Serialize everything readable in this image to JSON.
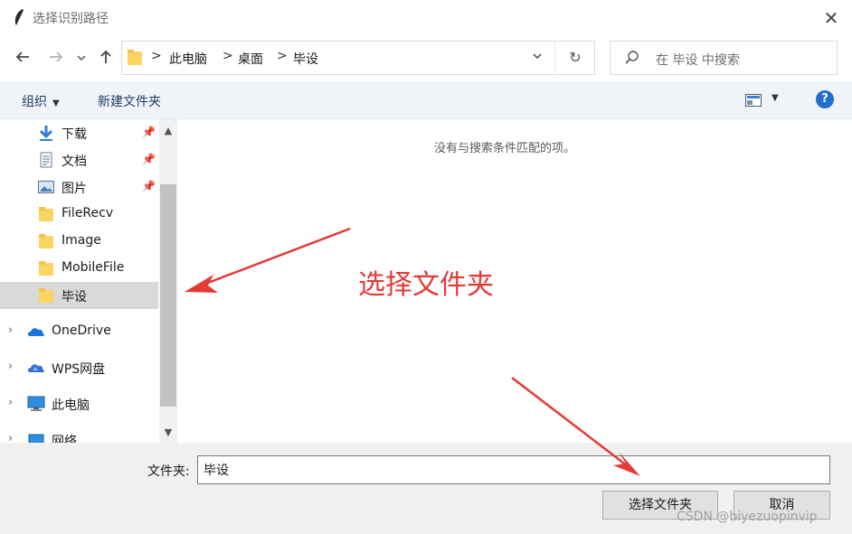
{
  "window": {
    "title": "选择识别路径",
    "close_glyph": "✕"
  },
  "nav": {
    "back_icon": "arrow-left-icon",
    "forward_icon": "arrow-right-icon",
    "recent_icon": "chevron-down-icon",
    "up_icon": "arrow-up-icon"
  },
  "address": {
    "crumbs": [
      "此电脑",
      "桌面",
      "毕设"
    ],
    "separator": ">",
    "dropdown_glyph": "⌄",
    "refresh_glyph": "↻"
  },
  "search": {
    "placeholder": "在 毕设 中搜索"
  },
  "toolbar": {
    "organize_label": "组织",
    "new_folder_label": "新建文件夹",
    "help_glyph": "?"
  },
  "sidebar": {
    "quick_access": [
      {
        "label": "下载",
        "icon": "download-icon",
        "pinned": true
      },
      {
        "label": "文档",
        "icon": "document-icon",
        "pinned": true
      },
      {
        "label": "图片",
        "icon": "pictures-icon",
        "pinned": true
      },
      {
        "label": "FileRecv",
        "icon": "folder-icon",
        "pinned": false
      },
      {
        "label": "Image",
        "icon": "folder-icon",
        "pinned": false
      },
      {
        "label": "MobileFile",
        "icon": "folder-icon",
        "pinned": false
      },
      {
        "label": "毕设",
        "icon": "folder-icon",
        "pinned": false,
        "selected": true
      }
    ],
    "groups": [
      {
        "label": "OneDrive",
        "icon": "onedrive-icon"
      },
      {
        "label": "WPS网盘",
        "icon": "wps-cloud-icon"
      },
      {
        "label": "此电脑",
        "icon": "computer-icon"
      },
      {
        "label": "网络",
        "icon": "network-icon"
      }
    ]
  },
  "content": {
    "empty_message": "没有与搜索条件匹配的项。"
  },
  "footer": {
    "folder_label": "文件夹:",
    "folder_value": "毕设",
    "select_button": "选择文件夹",
    "cancel_button": "取消"
  },
  "annotation": {
    "text": "选择文件夹",
    "color": "#e53935"
  },
  "watermark": "CSDN @biyezuopinvip"
}
